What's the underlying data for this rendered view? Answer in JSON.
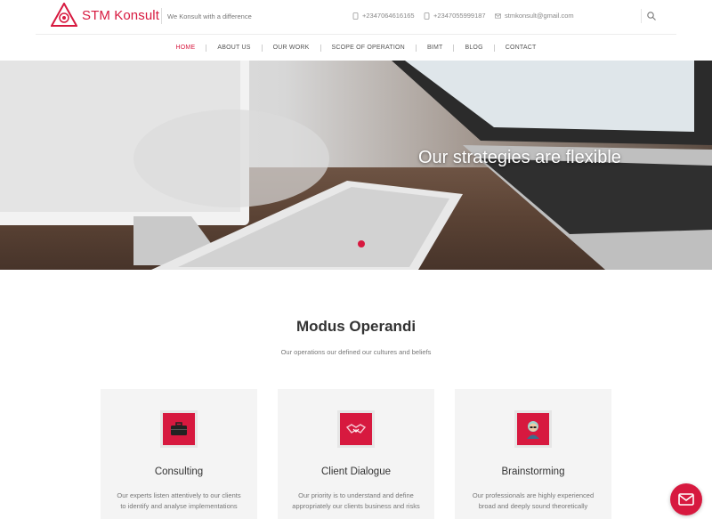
{
  "brand": {
    "name": "STM Konsult",
    "tagline": "We Konsult with a difference",
    "accent": "#d7193f"
  },
  "topbar": {
    "phone1": "+2347064616165",
    "phone2": "+2347055999187",
    "email": "stmkonsult@gmail.com",
    "icons": [
      "phone-icon",
      "phone-icon",
      "mail-icon",
      "search-icon"
    ]
  },
  "nav": {
    "items": [
      "HOME",
      "ABOUT US",
      "OUR WORK",
      "SCOPE OF OPERATION",
      "BIMT",
      "BLOG",
      "CONTACT"
    ],
    "active": "HOME"
  },
  "hero": {
    "title": "Our strategies are flexible"
  },
  "section": {
    "title": "Modus Operandi",
    "subtitle": "Our operations our defined our cultures and beliefs"
  },
  "cards": [
    {
      "title": "Consulting",
      "icon": "briefcase-icon",
      "text": "Our experts listen attentively to our clients to identify and analyse implementations"
    },
    {
      "title": "Client Dialogue",
      "icon": "handshake-icon",
      "text": "Our priority is to understand and define appropriately our clients business and risks"
    },
    {
      "title": "Brainstorming",
      "icon": "person-icon",
      "text": "Our professionals are highly experienced broad and deeply sound theoretically"
    }
  ],
  "fab": {
    "icon": "mail-icon"
  }
}
